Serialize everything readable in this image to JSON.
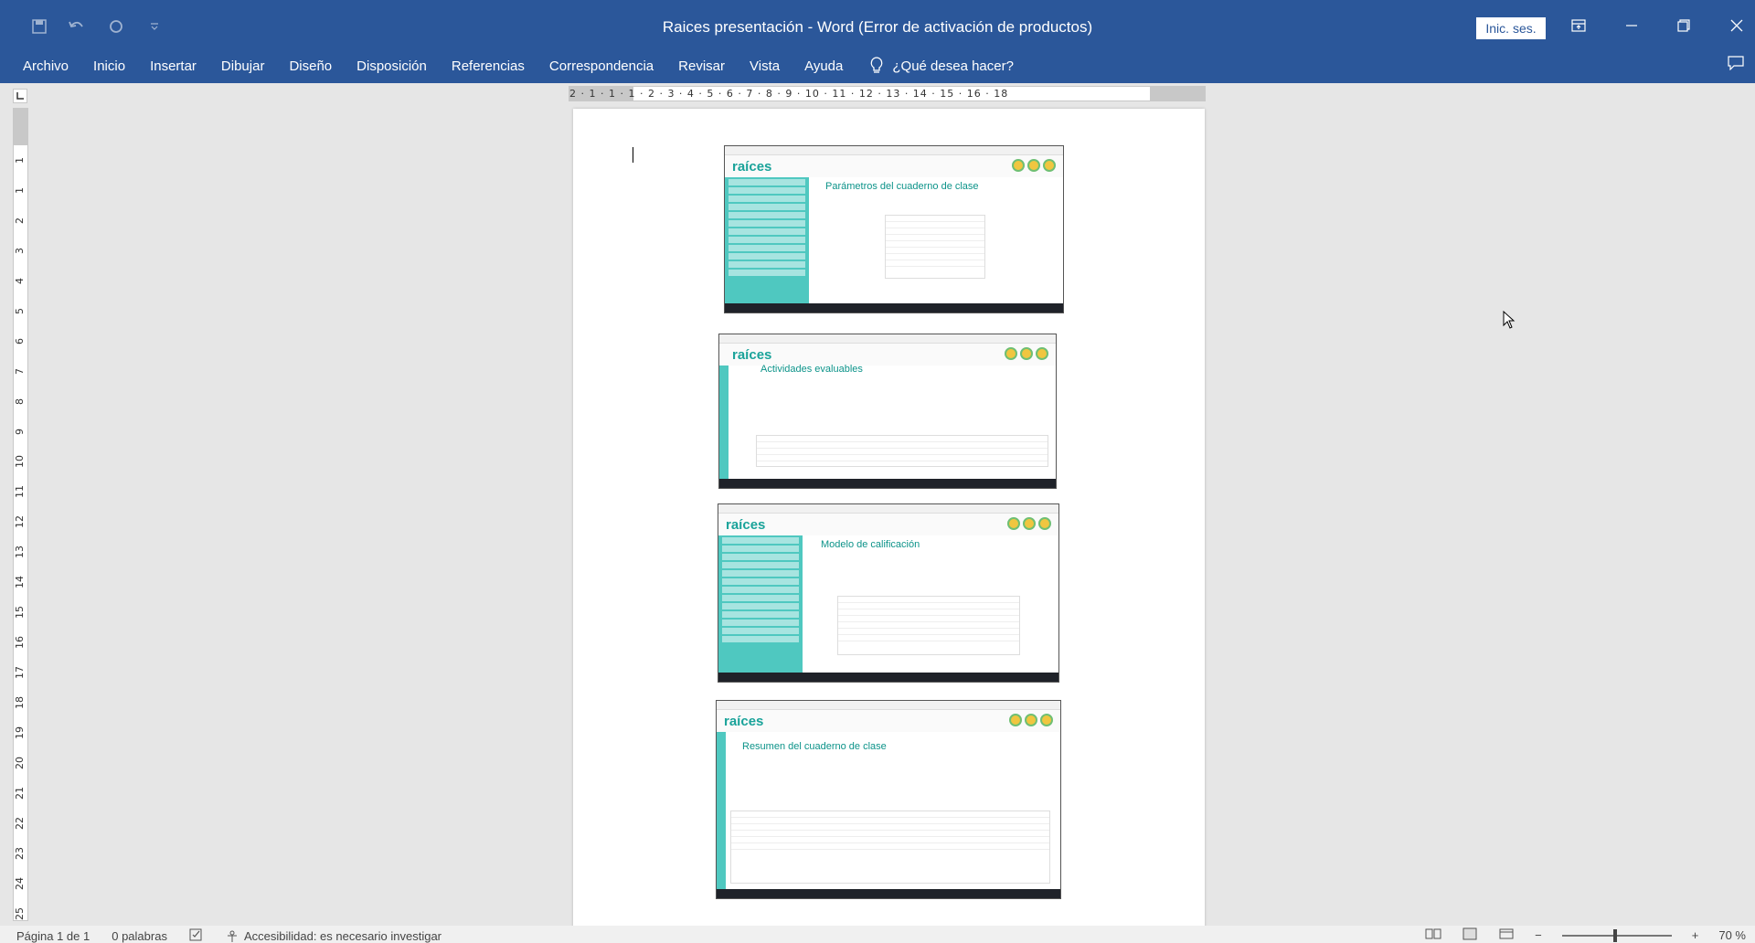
{
  "title_bar": {
    "title": "Raices presentación  -  Word (Error de activación de productos)",
    "signin_label": "Inic. ses."
  },
  "ribbon": {
    "tabs": [
      "Archivo",
      "Inicio",
      "Insertar",
      "Dibujar",
      "Diseño",
      "Disposición",
      "Referencias",
      "Correspondencia",
      "Revisar",
      "Vista",
      "Ayuda"
    ],
    "tell_me": "¿Qué desea hacer?"
  },
  "ruler": {
    "horizontal": "2 · 1 · 1 · 1 · 2 · 3 · 4 · 5 · 6 · 7 · 8 · 9 · 10 · 11 · 12 · 13 · 14 · 15 · 16 · 18",
    "vertical": [
      "1",
      "1",
      "2",
      "3",
      "4",
      "5",
      "6",
      "7",
      "8",
      "9",
      "10",
      "11",
      "12",
      "13",
      "14",
      "15",
      "16",
      "17",
      "18",
      "19",
      "20",
      "21",
      "22",
      "23",
      "24",
      "25"
    ]
  },
  "document": {
    "screenshots": [
      {
        "logo": "raíces",
        "heading": "Parámetros del cuaderno de clase"
      },
      {
        "logo": "raíces",
        "heading": "Actividades evaluables"
      },
      {
        "logo": "raíces",
        "heading": "Modelo de calificación"
      },
      {
        "logo": "raíces",
        "heading": "Resumen del cuaderno de clase"
      }
    ]
  },
  "status_bar": {
    "page": "Página 1 de 1",
    "words": "0 palabras",
    "accessibility": "Accesibilidad: es necesario investigar",
    "zoom": "70 %"
  },
  "colors": {
    "accent": "#2b579a",
    "teal": "#4fc8c0"
  }
}
